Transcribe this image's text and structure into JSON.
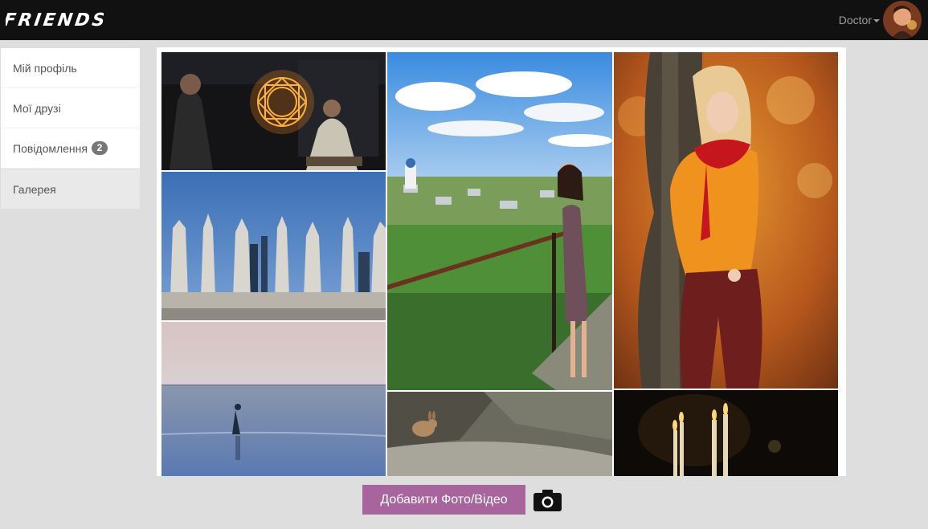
{
  "navbar": {
    "brand_text": "FRIENDS",
    "username": "Doctor",
    "avatar_icon": "user-avatar",
    "caret_icon": "caret-down-icon"
  },
  "sidebar": {
    "items": [
      {
        "label": "Мій профіль",
        "active": false
      },
      {
        "label": "Мої друзі",
        "active": false
      },
      {
        "label": "Повідомлення",
        "badge": "2",
        "active": false
      },
      {
        "label": "Галерея",
        "active": true
      }
    ]
  },
  "gallery": {
    "photos": [
      {
        "subject": "magic-circle-scene"
      },
      {
        "subject": "city-spires"
      },
      {
        "subject": "sea-walker"
      },
      {
        "subject": "woman-on-hill"
      },
      {
        "subject": "rabbit"
      },
      {
        "subject": "autumn-woman"
      },
      {
        "subject": "candles"
      }
    ]
  },
  "actions": {
    "add_button_label": "Добавити Фото/Відео",
    "camera_icon": "camera-icon"
  },
  "colors": {
    "navbar_bg": "#111111",
    "page_bg": "#dedede",
    "add_button_bg": "#a7649d",
    "badge_bg": "#777777"
  }
}
